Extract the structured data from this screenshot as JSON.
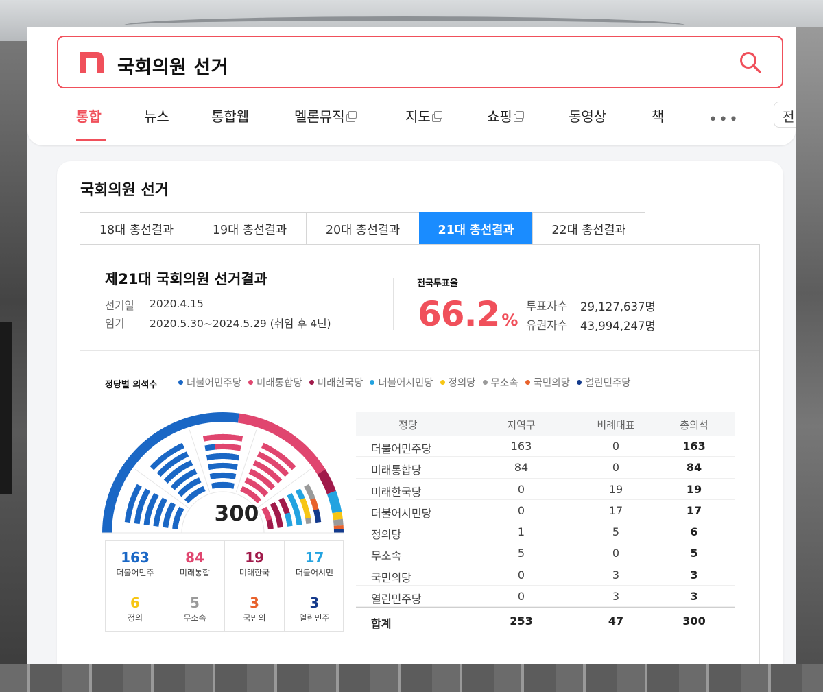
{
  "search": {
    "query": "국회의원 선거"
  },
  "tabs": [
    {
      "label": "통합",
      "active": true
    },
    {
      "label": "뉴스"
    },
    {
      "label": "통합웹"
    },
    {
      "label": "멜론뮤직",
      "external": true
    },
    {
      "label": "지도",
      "external": true
    },
    {
      "label": "쇼핑",
      "external": true
    },
    {
      "label": "동영상"
    },
    {
      "label": "책"
    }
  ],
  "all_button": "전",
  "card": {
    "title": "국회의원 선거",
    "election_tabs": [
      "18대 총선결과",
      "19대 총선결과",
      "20대 총선결과",
      "21대 총선결과",
      "22대 총선결과"
    ],
    "active_election_tab": 3,
    "summary": {
      "title": "제21대 국회의원 선거결과",
      "date_label": "선거일",
      "date": "2020.4.15",
      "term_label": "임기",
      "term": "2020.5.30~2024.5.29 (취임 후 4년)",
      "turnout_label": "전국투표율",
      "turnout": "66.2",
      "turnout_unit": "%",
      "voters_label": "투표자수",
      "voters": "29,127,637명",
      "electors_label": "유권자수",
      "electors": "43,994,247명"
    },
    "seats_title": "정당별 의석수",
    "total_seats": "300",
    "parties": [
      {
        "name": "더불어민주당",
        "short": "더불어민주",
        "district": "163",
        "pr": "0",
        "total": "163",
        "color": "#1a67c5"
      },
      {
        "name": "미래통합당",
        "short": "미래통합",
        "district": "84",
        "pr": "0",
        "total": "84",
        "color": "#e0466f"
      },
      {
        "name": "미래한국당",
        "short": "미래한국",
        "district": "0",
        "pr": "19",
        "total": "19",
        "color": "#a01a4a"
      },
      {
        "name": "더불어시민당",
        "short": "더불어시민",
        "district": "0",
        "pr": "17",
        "total": "17",
        "color": "#23a3e0"
      },
      {
        "name": "정의당",
        "short": "정의",
        "district": "1",
        "pr": "5",
        "total": "6",
        "color": "#f7c615"
      },
      {
        "name": "무소속",
        "short": "무소속",
        "district": "5",
        "pr": "0",
        "total": "5",
        "color": "#9a9a9a"
      },
      {
        "name": "국민의당",
        "short": "국민의",
        "district": "0",
        "pr": "3",
        "total": "3",
        "color": "#e8622c"
      },
      {
        "name": "열린민주당",
        "short": "열린민주",
        "district": "0",
        "pr": "3",
        "total": "3",
        "color": "#133a8c"
      }
    ],
    "table": {
      "headers": [
        "정당",
        "지역구",
        "비례대표",
        "총의석"
      ],
      "total_label": "합계",
      "total_district": "253",
      "total_pr": "47",
      "total_all": "300"
    }
  }
}
